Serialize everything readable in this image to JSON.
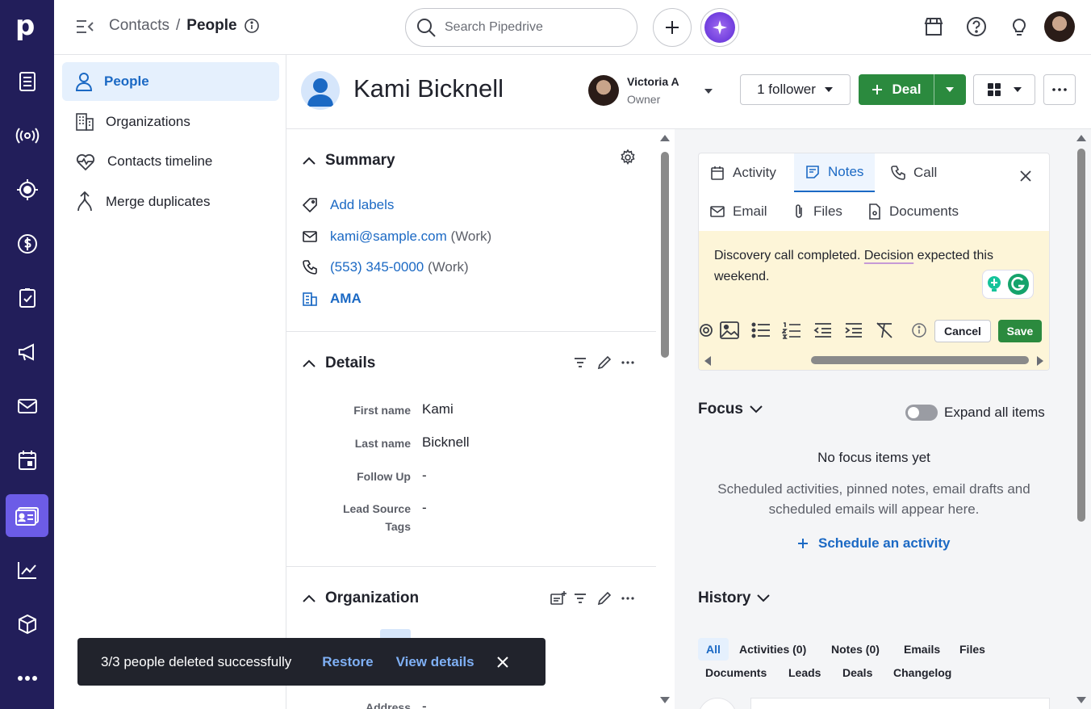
{
  "rail": {
    "logo": "p",
    "items": [
      "deals-list-icon",
      "leads-icon",
      "radar-icon",
      "dollar-icon",
      "clipboard-check-icon",
      "megaphone-icon",
      "mail-icon",
      "calendar-icon",
      "contacts-card-icon",
      "chart-icon",
      "cube-icon",
      "more-icon"
    ]
  },
  "topbar": {
    "crumb_parent": "Contacts",
    "crumb_sep": "/",
    "crumb_current": "People",
    "search_placeholder": "Search Pipedrive"
  },
  "subnav": {
    "items": [
      {
        "label": "People",
        "icon": "person-icon",
        "active": true
      },
      {
        "label": "Organizations",
        "icon": "building-icon"
      },
      {
        "label": "Contacts timeline",
        "icon": "heart-pulse-icon"
      },
      {
        "label": "Merge duplicates",
        "icon": "merge-icon"
      }
    ]
  },
  "record": {
    "name": "Kami Bicknell",
    "owner_name": "Victoria A",
    "owner_role": "Owner",
    "follower_label": "1 follower",
    "deal_label": "Deal"
  },
  "summary": {
    "title": "Summary",
    "add_labels": "Add labels",
    "email": "kami@sample.com",
    "email_type": "(Work)",
    "phone": "(553) 345-0000",
    "phone_type": "(Work)",
    "org": "AMA"
  },
  "details": {
    "title": "Details",
    "fields": [
      {
        "label": "First name",
        "value": "Kami"
      },
      {
        "label": "Last name",
        "value": "Bicknell"
      },
      {
        "label": "Follow Up",
        "value": "-"
      },
      {
        "label": "Lead Source",
        "value": "-"
      },
      {
        "label": "Tags",
        "value": ""
      }
    ]
  },
  "organization": {
    "title": "Organization",
    "address_label": "Address",
    "address_value": "-"
  },
  "composer": {
    "tabs": [
      "Activity",
      "Notes",
      "Call",
      "Email",
      "Files",
      "Documents"
    ],
    "active_tab": "Notes",
    "note_text_1": "Discovery call completed.",
    "note_text_2": "Decision",
    "note_text_3": "expected this weekend.",
    "cancel_label": "Cancel",
    "save_label": "Save"
  },
  "focus": {
    "title": "Focus",
    "expand_label": "Expand all items",
    "empty_title": "No focus items yet",
    "empty_desc": "Scheduled activities, pinned notes, email drafts and scheduled emails will appear here.",
    "schedule_label": "Schedule an activity"
  },
  "history": {
    "title": "History",
    "tabs": [
      "All",
      "Activities (0)",
      "Notes (0)",
      "Emails",
      "Files",
      "Documents",
      "Leads",
      "Deals",
      "Changelog"
    ],
    "active_tab": "All"
  },
  "toast": {
    "message": "3/3 people deleted successfully",
    "restore": "Restore",
    "view_details": "View details"
  },
  "colors": {
    "rail": "#221e5a",
    "accent": "#1b69c4",
    "deal_green": "#2b8a3e",
    "active_rail": "#6c5ce7"
  }
}
